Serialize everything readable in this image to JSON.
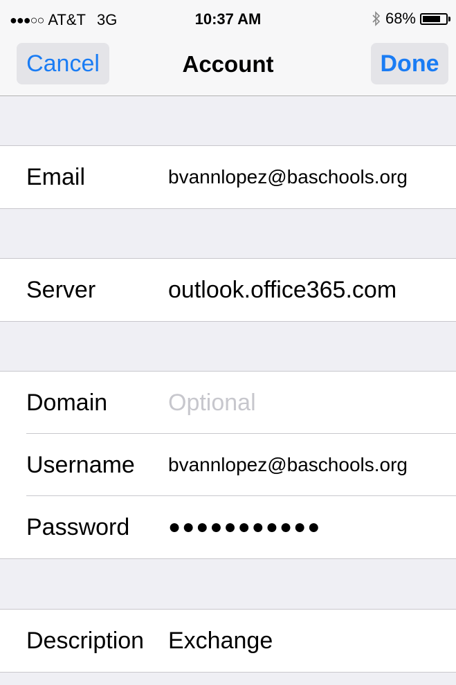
{
  "status_bar": {
    "carrier": "AT&T",
    "network": "3G",
    "time": "10:37 AM",
    "battery_percent": "68%",
    "signal_icon": "signal-dots-icon",
    "bluetooth_icon": "bluetooth-icon",
    "battery_icon": "battery-icon"
  },
  "nav": {
    "cancel_label": "Cancel",
    "title": "Account",
    "done_label": "Done",
    "accent_color": "#1a7cf4"
  },
  "fields": {
    "email": {
      "label": "Email",
      "value": "bvannlopez@baschools.org"
    },
    "server": {
      "label": "Server",
      "value": "outlook.office365.com"
    },
    "domain": {
      "label": "Domain",
      "value": "",
      "placeholder": "Optional"
    },
    "username": {
      "label": "Username",
      "value": "bvannlopez@baschools.org"
    },
    "password": {
      "label": "Password",
      "value": "●●●●●●●●●●●"
    },
    "description": {
      "label": "Description",
      "value": "Exchange"
    }
  }
}
